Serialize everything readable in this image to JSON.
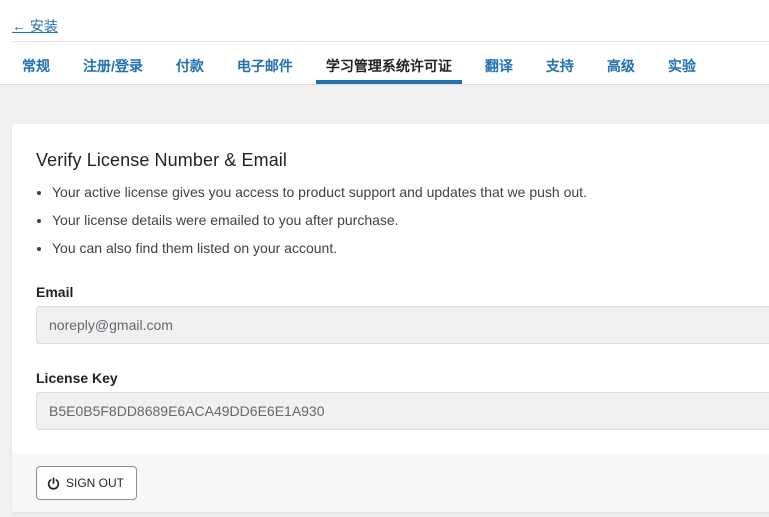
{
  "nav": {
    "back_link": "← 安装"
  },
  "tabs": [
    {
      "label": "常规",
      "active": false
    },
    {
      "label": "注册/登录",
      "active": false
    },
    {
      "label": "付款",
      "active": false
    },
    {
      "label": "电子邮件",
      "active": false
    },
    {
      "label": "学习管理系统许可证",
      "active": true
    },
    {
      "label": "翻译",
      "active": false
    },
    {
      "label": "支持",
      "active": false
    },
    {
      "label": "高级",
      "active": false
    },
    {
      "label": "实验",
      "active": false
    }
  ],
  "card": {
    "title": "Verify License Number & Email",
    "bullets": [
      "Your active license gives you access to product support and updates that we push out.",
      "Your license details were emailed to you after purchase.",
      "You can also find them listed on your account."
    ],
    "email": {
      "label": "Email",
      "value": "noreply@gmail.com"
    },
    "license_key": {
      "label": "License Key",
      "value": "B5E0B5F8DD8689E6ACA49DD6E6E1A930"
    },
    "signout_button": {
      "label": "SIGN OUT",
      "icon": "power-icon"
    }
  },
  "colors": {
    "accent": "#2271b1",
    "page_background": "#f0f0f1",
    "text": "#1d2327"
  }
}
